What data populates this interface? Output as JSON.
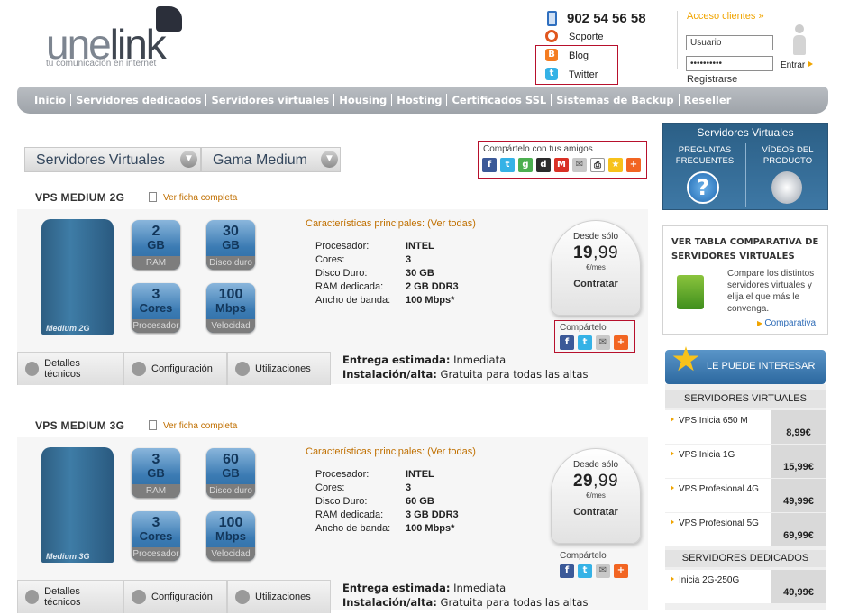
{
  "header": {
    "logo_une": "une",
    "logo_link": "link",
    "tagline": "tu comunicación en internet",
    "phone": "902 54 56 58",
    "links": {
      "support": "Soporte",
      "blog": "Blog",
      "twitter": "Twitter"
    },
    "login": {
      "title": "Acceso clientes »",
      "user_value": "Usuario",
      "password_value": "••••••••••",
      "enter_label": "Entrar",
      "register_label": "Registrarse"
    }
  },
  "nav": {
    "items": [
      "Inicio",
      "Servidores dedicados",
      "Servidores virtuales",
      "Housing",
      "Hosting",
      "Certificados SSL",
      "Sistemas de Backup",
      "Reseller"
    ]
  },
  "breadcrumb": {
    "level1": "Servidores Virtuales",
    "level2": "Gama Medium"
  },
  "share": {
    "title": "Compártelo con tus amigos",
    "small_title": "Compártelo"
  },
  "products": [
    {
      "title": "VPS MEDIUM 2G",
      "ficha": "Ver ficha completa",
      "server_label": "Medium 2G",
      "specs": [
        {
          "v1": "2",
          "v2": "GB",
          "cap": "RAM"
        },
        {
          "v1": "30",
          "v2": "GB",
          "cap": "Disco duro"
        },
        {
          "v1": "3",
          "v2": "Cores",
          "cap": "Procesador"
        },
        {
          "v1": "100",
          "v2": "Mbps",
          "cap": "Velocidad"
        }
      ],
      "carac_label": "Características principales:",
      "carac_link": "(Ver todas)",
      "kv": [
        {
          "k": "Procesador:",
          "v": "INTEL"
        },
        {
          "k": "Cores:",
          "v": "3"
        },
        {
          "k": "Disco Duro:",
          "v": "30 GB"
        },
        {
          "k": "RAM dedicada:",
          "v": "2 GB DDR3"
        },
        {
          "k": "Ancho de banda:",
          "v": "100 Mbps*"
        }
      ],
      "price": {
        "desde": "Desde sólo",
        "int": "19",
        "dec": ",99",
        "per": "€/mes",
        "btn": "Contratar"
      },
      "tabs": [
        "Detalles técnicos",
        "Configuración",
        "Utilizaciones"
      ],
      "entrega_k": "Entrega estimada:",
      "entrega_v": " Inmediata",
      "alta_k": "Instalación/alta:",
      "alta_v": " Gratuita para todas las altas"
    },
    {
      "title": "VPS MEDIUM 3G",
      "ficha": "Ver ficha completa",
      "server_label": "Medium 3G",
      "specs": [
        {
          "v1": "3",
          "v2": "GB",
          "cap": "RAM"
        },
        {
          "v1": "60",
          "v2": "GB",
          "cap": "Disco duro"
        },
        {
          "v1": "3",
          "v2": "Cores",
          "cap": "Procesador"
        },
        {
          "v1": "100",
          "v2": "Mbps",
          "cap": "Velocidad"
        }
      ],
      "carac_label": "Características principales:",
      "carac_link": "(Ver todas)",
      "kv": [
        {
          "k": "Procesador:",
          "v": "INTEL"
        },
        {
          "k": "Cores:",
          "v": "3"
        },
        {
          "k": "Disco Duro:",
          "v": "60 GB"
        },
        {
          "k": "RAM dedicada:",
          "v": "3 GB DDR3"
        },
        {
          "k": "Ancho de banda:",
          "v": "100 Mbps*"
        }
      ],
      "price": {
        "desde": "Desde sólo",
        "int": "29",
        "dec": ",99",
        "per": "€/mes",
        "btn": "Contratar"
      },
      "tabs": [
        "Detalles técnicos",
        "Configuración",
        "Utilizaciones"
      ],
      "entrega_k": "Entrega estimada:",
      "entrega_v": " Inmediata",
      "alta_k": "Instalación/alta:",
      "alta_v": " Gratuita para todas las altas"
    }
  ],
  "sidebar": {
    "sv_title": "Servidores Virtuales",
    "faq": "PREGUNTAS FRECUENTES",
    "videos": "VÍDEOS DEL PRODUCTO",
    "cmp_title": "VER TABLA COMPARATIVA DE SERVIDORES VIRTUALES",
    "cmp_text": "Compare los distintos servidores virtuales y elija el que más le convenga.",
    "cmp_link": "Comparativa",
    "interes": "LE PUEDE INTERESAR",
    "group1": "SERVIDORES VIRTUALES",
    "group1_items": [
      {
        "name": "VPS Inicia 650 M",
        "price": "8,99€"
      },
      {
        "name": "VPS Inicia 1G",
        "price": "15,99€"
      },
      {
        "name": "VPS Profesional 4G",
        "price": "49,99€"
      },
      {
        "name": "VPS Profesional 5G",
        "price": "69,99€"
      }
    ],
    "group2": "SERVIDORES DEDICADOS",
    "group2_items": [
      {
        "name": "Inicia 2G-250G",
        "price": "49,99€"
      }
    ]
  }
}
